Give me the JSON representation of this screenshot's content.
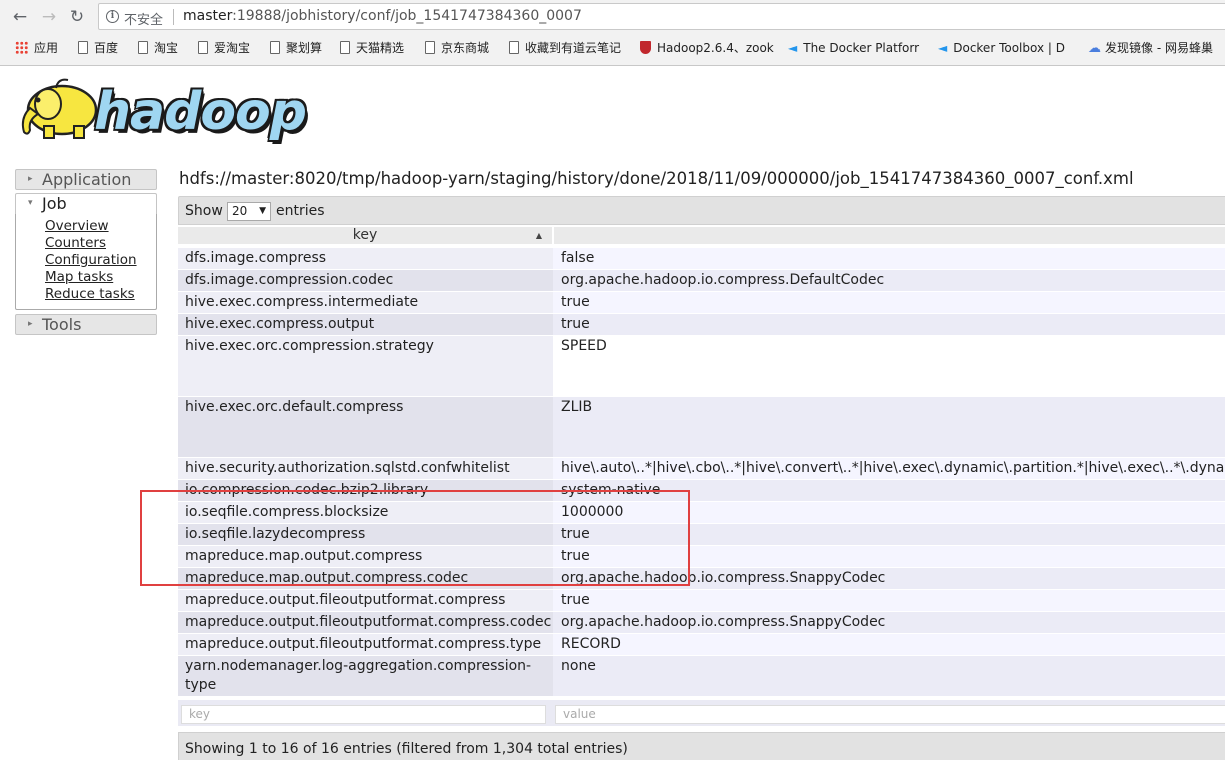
{
  "browser": {
    "back_icon": "back-arrow-icon",
    "forward_icon": "forward-arrow-icon",
    "reload_icon": "reload-icon",
    "insecure_label": "不安全",
    "url_host": "master",
    "url_rest": ":19888/jobhistory/conf/job_1541747384360_0007",
    "bookmarks": [
      {
        "label": "应用",
        "icon": "apps-grid-icon"
      },
      {
        "label": "百度",
        "icon": "page-icon"
      },
      {
        "label": "淘宝",
        "icon": "page-icon"
      },
      {
        "label": "爱淘宝",
        "icon": "page-icon"
      },
      {
        "label": "聚划算",
        "icon": "page-icon"
      },
      {
        "label": "天猫精选",
        "icon": "page-icon"
      },
      {
        "label": "京东商城",
        "icon": "page-icon"
      },
      {
        "label": "收藏到有道云笔记",
        "icon": "page-icon"
      },
      {
        "label": "Hadoop2.6.4、zook",
        "icon": "shield-icon"
      },
      {
        "label": "The Docker Platforr",
        "icon": "docker-whale-icon"
      },
      {
        "label": "Docker Toolbox | D",
        "icon": "docker-whale-icon"
      },
      {
        "label": "发现镜像 - 网易蜂巢",
        "icon": "cloud-icon"
      }
    ]
  },
  "logo": {
    "text_main": "hadoop"
  },
  "sidebar": {
    "sections": [
      {
        "label": "Application",
        "expanded": false
      },
      {
        "label": "Job",
        "expanded": true,
        "links": [
          "Overview",
          "Counters",
          "Configuration",
          "Map tasks",
          "Reduce tasks"
        ]
      },
      {
        "label": "Tools",
        "expanded": false
      }
    ]
  },
  "main": {
    "conf_path": "hdfs://master:8020/tmp/hadoop-yarn/staging/history/done/2018/11/09/000000/job_1541747384360_0007_conf.xml",
    "show_label": "Show",
    "page_size": "20",
    "entries_label": "entries",
    "columns": [
      "key",
      ""
    ],
    "rows": [
      {
        "key": "dfs.image.compress",
        "value": "false"
      },
      {
        "key": "dfs.image.compression.codec",
        "value": "org.apache.hadoop.io.compress.DefaultCodec"
      },
      {
        "key": "hive.exec.compress.intermediate",
        "value": "true"
      },
      {
        "key": "hive.exec.compress.output",
        "value": "true"
      },
      {
        "key": "hive.exec.orc.compression.strategy",
        "value": "SPEED"
      },
      {
        "key": "hive.exec.orc.default.compress",
        "value": "ZLIB"
      },
      {
        "key": "hive.security.authorization.sqlstd.confwhitelist",
        "value": "hive\\.auto\\..*|hive\\.cbo\\..*|hive\\.convert\\..*|hive\\.exec\\.dynamic\\.partition.*|hive\\.exec\\..*\\.dynamic"
      },
      {
        "key": "io.compression.codec.bzip2.library",
        "value": "system-native"
      },
      {
        "key": "io.seqfile.compress.blocksize",
        "value": "1000000"
      },
      {
        "key": "io.seqfile.lazydecompress",
        "value": "true"
      },
      {
        "key": "mapreduce.map.output.compress",
        "value": "true"
      },
      {
        "key": "mapreduce.map.output.compress.codec",
        "value": "org.apache.hadoop.io.compress.SnappyCodec"
      },
      {
        "key": "mapreduce.output.fileoutputformat.compress",
        "value": "true"
      },
      {
        "key": "mapreduce.output.fileoutputformat.compress.codec",
        "value": "org.apache.hadoop.io.compress.SnappyCodec"
      },
      {
        "key": "mapreduce.output.fileoutputformat.compress.type",
        "value": "RECORD"
      },
      {
        "key": "yarn.nodemanager.log-aggregation.compression-type",
        "value": "none"
      }
    ],
    "filter_key_placeholder": "key",
    "filter_value_placeholder": "value",
    "info": "Showing 1 to 16 of 16 entries (filtered from 1,304 total entries)"
  },
  "colors": {
    "highlight": "#e04040",
    "row_odd": "#f5f5ff",
    "row_even": "#ebebf6"
  }
}
